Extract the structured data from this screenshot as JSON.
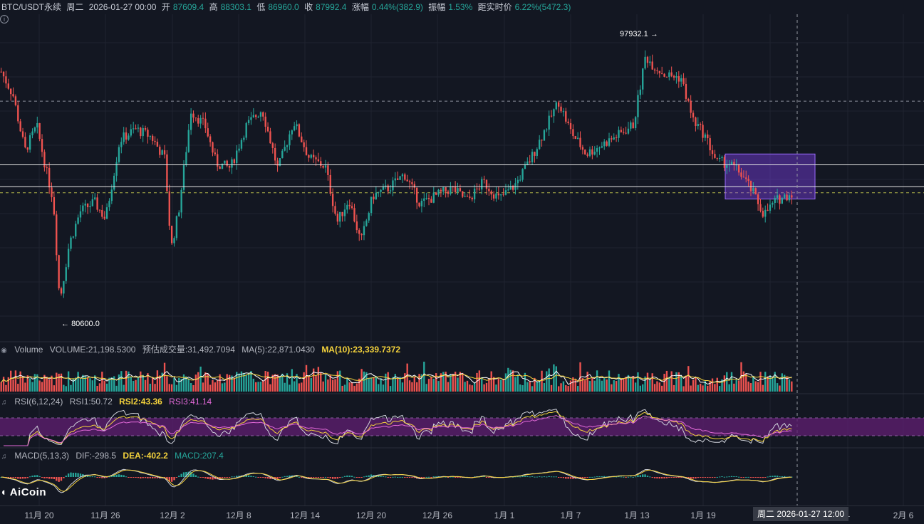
{
  "header": {
    "symbol": "BTC/USDT永续",
    "weekday": "周二",
    "datetime": "2026-01-27 00:00",
    "open_label": "开",
    "open": "87609.4",
    "high_label": "高",
    "high": "88303.1",
    "low_label": "低",
    "low": "86960.0",
    "close_label": "收",
    "close": "87992.4",
    "change_label": "涨幅",
    "change": "0.44%(382.9)",
    "amplitude_label": "振幅",
    "amplitude": "1.53%",
    "distance_label": "距实时价",
    "distance": "6.22%(5472.3)"
  },
  "info_icon": "i",
  "volume_pane": {
    "title": "Volume",
    "volume": "VOLUME:21,198.5300",
    "estimated": "预估成交量:31,492.7094",
    "ma5": "MA(5):22,871.0430",
    "ma10": "MA(10):23,339.7372"
  },
  "rsi_pane": {
    "title": "RSI(6,12,24)",
    "rsi1": "RSI1:50.72",
    "rsi2": "RSI2:43.36",
    "rsi3": "RSI3:41.14"
  },
  "macd_pane": {
    "title": "MACD(5,13,3)",
    "dif": "DIF:-298.5",
    "dea": "DEA:-402.2",
    "macd": "MACD:207.4"
  },
  "logo_text": "AiCoin",
  "x_axis": {
    "ticks": [
      "11月 20",
      "11月 26",
      "12月 2",
      "12月 8",
      "12月 14",
      "12月 20",
      "12月 26",
      "1月 1",
      "1月 7",
      "1月 13",
      "1月 19",
      "1",
      "2月 6"
    ],
    "cursor_label": "周二 2026-01-27 12:00"
  },
  "chart_data": {
    "type": "candlestick",
    "x_range": [
      "11月 17",
      "2月 7"
    ],
    "y_range": [
      78500,
      99500
    ],
    "annotations": [
      {
        "label": "97932.1",
        "value": 97932.1,
        "kind": "high"
      },
      {
        "label": "80600.0",
        "value": 80600.0,
        "kind": "low"
      }
    ],
    "horizontal_lines": {
      "solid_white": [
        89800,
        88400
      ],
      "dashed_grey": [
        93900
      ],
      "dashed_yellow": [
        88000
      ]
    },
    "highlight_box": {
      "price_top": 90500,
      "price_bottom": 87600,
      "color": "#7b3fe4"
    },
    "grid": true,
    "colors": {
      "up": "#26a69a",
      "down": "#ef5350",
      "ma5": "#ffffff",
      "ma10": "#f5d33c",
      "rsi_band": "#5c1e6e",
      "rsi1": "#d1d4dc",
      "rsi2": "#f5d33c",
      "rsi3": "#e36ad9"
    },
    "close_series": [
      {
        "pos": 0.0,
        "close": 95800
      },
      {
        "pos": 0.015,
        "close": 94300
      },
      {
        "pos": 0.03,
        "close": 90700
      },
      {
        "pos": 0.045,
        "close": 92300
      },
      {
        "pos": 0.058,
        "close": 89200
      },
      {
        "pos": 0.066,
        "close": 87500
      },
      {
        "pos": 0.074,
        "close": 81000
      },
      {
        "pos": 0.086,
        "close": 84700
      },
      {
        "pos": 0.1,
        "close": 86800
      },
      {
        "pos": 0.118,
        "close": 87400
      },
      {
        "pos": 0.132,
        "close": 86300
      },
      {
        "pos": 0.15,
        "close": 91400
      },
      {
        "pos": 0.17,
        "close": 92100
      },
      {
        "pos": 0.19,
        "close": 91600
      },
      {
        "pos": 0.207,
        "close": 90200
      },
      {
        "pos": 0.215,
        "close": 84400
      },
      {
        "pos": 0.225,
        "close": 87000
      },
      {
        "pos": 0.24,
        "close": 93300
      },
      {
        "pos": 0.258,
        "close": 92300
      },
      {
        "pos": 0.272,
        "close": 89900
      },
      {
        "pos": 0.29,
        "close": 89600
      },
      {
        "pos": 0.31,
        "close": 92300
      },
      {
        "pos": 0.33,
        "close": 93400
      },
      {
        "pos": 0.35,
        "close": 89500
      },
      {
        "pos": 0.37,
        "close": 92600
      },
      {
        "pos": 0.39,
        "close": 90200
      },
      {
        "pos": 0.41,
        "close": 89700
      },
      {
        "pos": 0.425,
        "close": 86100
      },
      {
        "pos": 0.44,
        "close": 87600
      },
      {
        "pos": 0.455,
        "close": 84800
      },
      {
        "pos": 0.47,
        "close": 87800
      },
      {
        "pos": 0.49,
        "close": 88300
      },
      {
        "pos": 0.51,
        "close": 89200
      },
      {
        "pos": 0.53,
        "close": 87300
      },
      {
        "pos": 0.55,
        "close": 87800
      },
      {
        "pos": 0.57,
        "close": 88300
      },
      {
        "pos": 0.59,
        "close": 87500
      },
      {
        "pos": 0.61,
        "close": 88700
      },
      {
        "pos": 0.63,
        "close": 87600
      },
      {
        "pos": 0.65,
        "close": 88500
      },
      {
        "pos": 0.67,
        "close": 90200
      },
      {
        "pos": 0.69,
        "close": 92300
      },
      {
        "pos": 0.705,
        "close": 93900
      },
      {
        "pos": 0.72,
        "close": 92000
      },
      {
        "pos": 0.74,
        "close": 90500
      },
      {
        "pos": 0.76,
        "close": 91100
      },
      {
        "pos": 0.78,
        "close": 91700
      },
      {
        "pos": 0.8,
        "close": 92400
      },
      {
        "pos": 0.815,
        "close": 96800
      },
      {
        "pos": 0.825,
        "close": 96200
      },
      {
        "pos": 0.84,
        "close": 95600
      },
      {
        "pos": 0.86,
        "close": 95400
      },
      {
        "pos": 0.875,
        "close": 92700
      },
      {
        "pos": 0.89,
        "close": 91700
      },
      {
        "pos": 0.905,
        "close": 90000
      },
      {
        "pos": 0.92,
        "close": 89900
      },
      {
        "pos": 0.935,
        "close": 89300
      },
      {
        "pos": 0.95,
        "close": 88100
      },
      {
        "pos": 0.965,
        "close": 86600
      },
      {
        "pos": 0.98,
        "close": 87500
      },
      {
        "pos": 1.0,
        "close": 87992.4
      }
    ]
  }
}
